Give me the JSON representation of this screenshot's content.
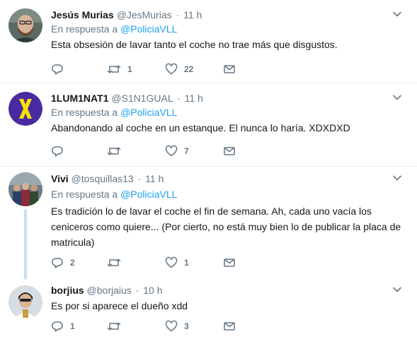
{
  "tweets": [
    {
      "name": "Jesús Murias",
      "handle": "@JesMurias",
      "dot": "·",
      "time": "11 h",
      "reply_prefix": "En respuesta a",
      "mention": "@PoliciaVLL",
      "text": "Esta obsesión de lavar tanto el coche no trae más que disgustos.",
      "replies": "",
      "retweets": "1",
      "likes": "22"
    },
    {
      "name": "1LUM1NAT1",
      "handle": "@S1N1GUAL",
      "dot": "·",
      "time": "11 h",
      "reply_prefix": "En respuesta a",
      "mention": "@PoliciaVLL",
      "text": "Abandonando al coche en un estanque. El nunca lo haría. XDXDXD",
      "replies": "",
      "retweets": "",
      "likes": "7"
    },
    {
      "name": "Vivi",
      "handle": "@tosquillas13",
      "dot": "·",
      "time": "11 h",
      "reply_prefix": "En respuesta a",
      "mention": "@PoliciaVLL",
      "text": "Es tradición lo de lavar el coche el fin de semana. Ah, cada uno vacía los ceniceros como quiere... (Por cierto, no está muy bien lo de publicar la placa de matricula)",
      "replies": "2",
      "retweets": "",
      "likes": "1"
    },
    {
      "name": "borjius",
      "handle": "@borjaius",
      "dot": "·",
      "time": "10 h",
      "text": "Es por si aparece el dueño  xdd",
      "replies": "1",
      "retweets": "",
      "likes": "3"
    }
  ],
  "colors": {
    "link": "#1da1f2",
    "muted": "#657786",
    "thread_line": "#c4e0f5",
    "divider": "#e6ecf0",
    "logo_bg": "#4a2aa0",
    "logo_fg": "#f6e300"
  },
  "icons": [
    "reply-icon",
    "retweet-icon",
    "like-icon",
    "message-icon",
    "chevron-down-icon"
  ]
}
